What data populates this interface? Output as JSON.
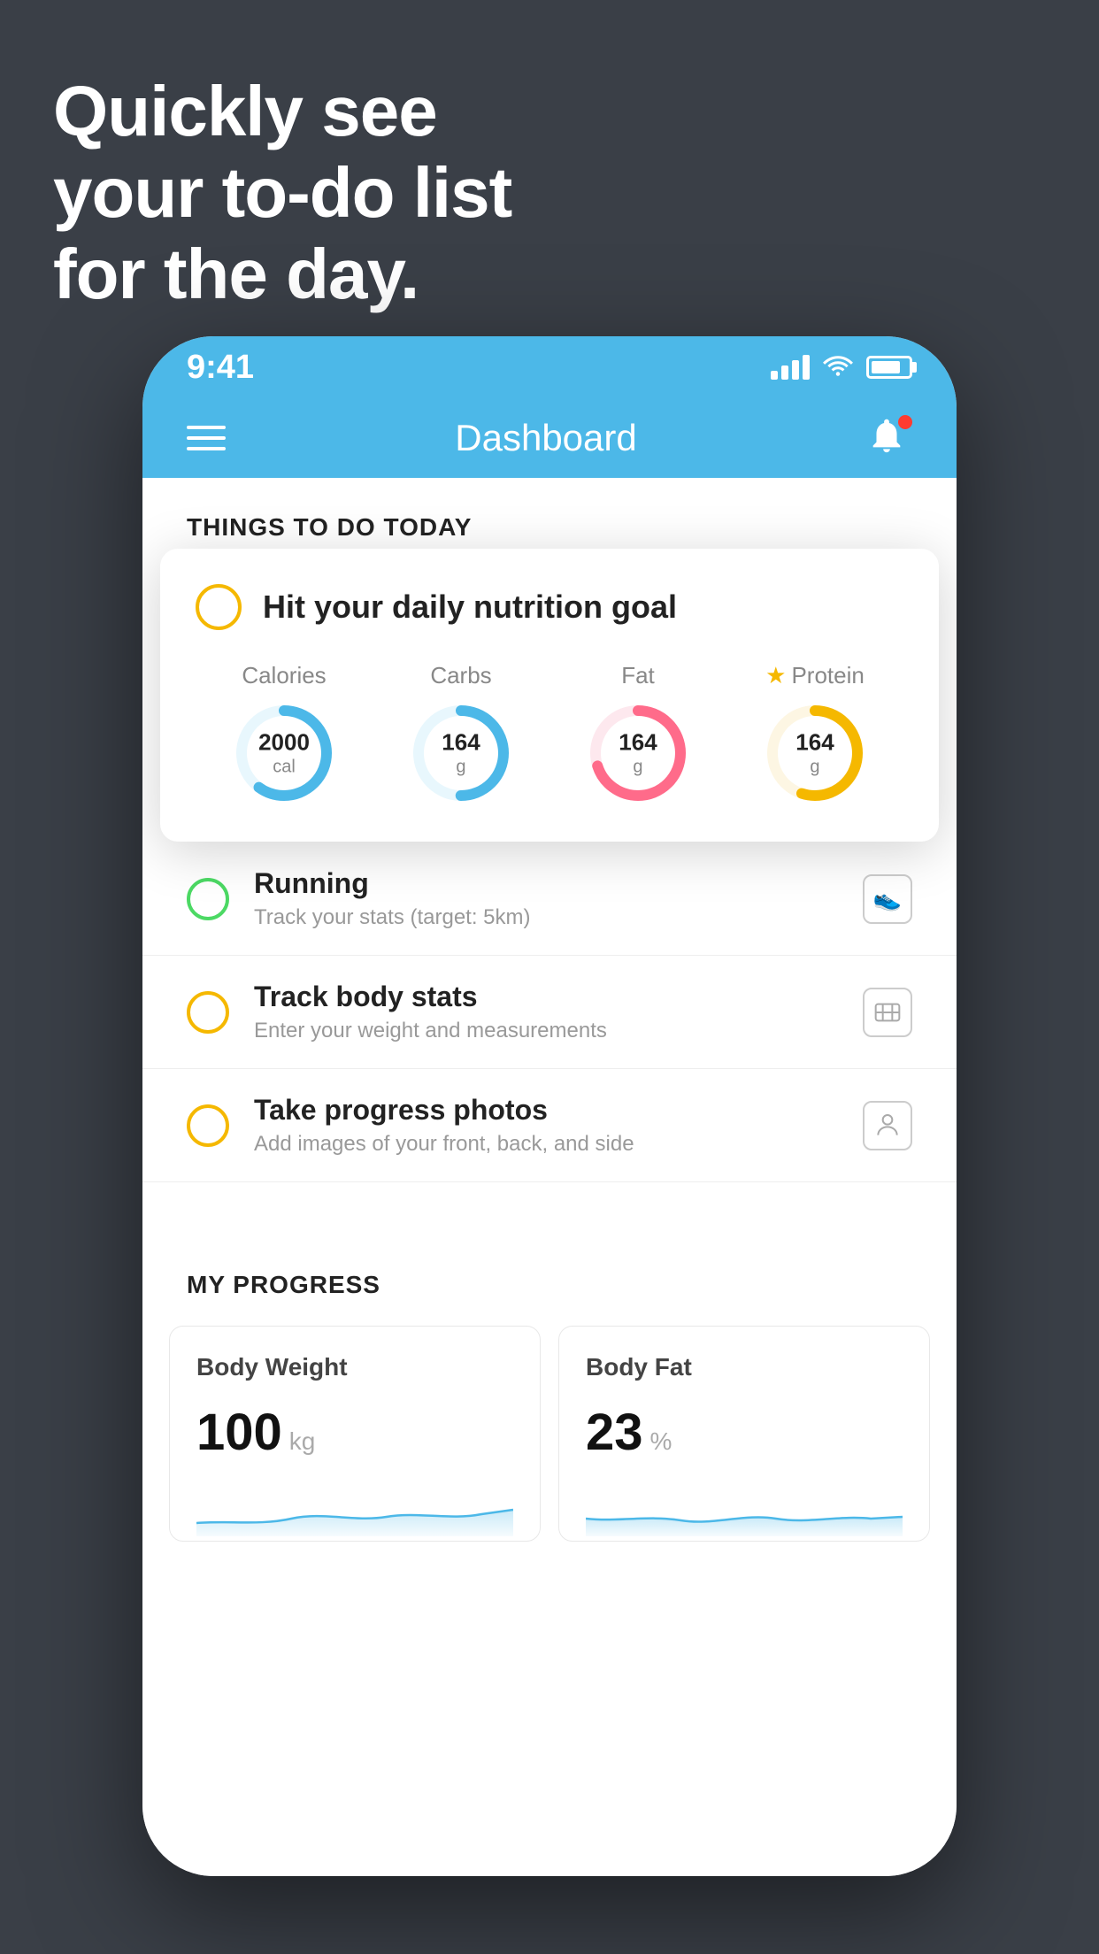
{
  "headline": {
    "line1": "Quickly see",
    "line2": "your to-do list",
    "line3": "for the day."
  },
  "statusBar": {
    "time": "9:41"
  },
  "navBar": {
    "title": "Dashboard"
  },
  "thingsToDoSection": {
    "header": "THINGS TO DO TODAY"
  },
  "nutritionCard": {
    "checkType": "yellow-circle",
    "title": "Hit your daily nutrition goal",
    "items": [
      {
        "label": "Calories",
        "value": "2000",
        "unit": "cal",
        "color": "#4cb8e8",
        "percent": 60,
        "starred": false
      },
      {
        "label": "Carbs",
        "value": "164",
        "unit": "g",
        "color": "#4cb8e8",
        "percent": 50,
        "starred": false
      },
      {
        "label": "Fat",
        "value": "164",
        "unit": "g",
        "color": "#ff6b8a",
        "percent": 70,
        "starred": false
      },
      {
        "label": "Protein",
        "value": "164",
        "unit": "g",
        "color": "#f5b800",
        "percent": 55,
        "starred": true
      }
    ]
  },
  "listItems": [
    {
      "title": "Running",
      "subtitle": "Track your stats (target: 5km)",
      "circleColor": "green",
      "icon": "shoe"
    },
    {
      "title": "Track body stats",
      "subtitle": "Enter your weight and measurements",
      "circleColor": "yellow",
      "icon": "scale"
    },
    {
      "title": "Take progress photos",
      "subtitle": "Add images of your front, back, and side",
      "circleColor": "yellow",
      "icon": "person"
    }
  ],
  "progressSection": {
    "header": "MY PROGRESS",
    "cards": [
      {
        "title": "Body Weight",
        "value": "100",
        "unit": "kg"
      },
      {
        "title": "Body Fat",
        "value": "23",
        "unit": "%"
      }
    ]
  }
}
